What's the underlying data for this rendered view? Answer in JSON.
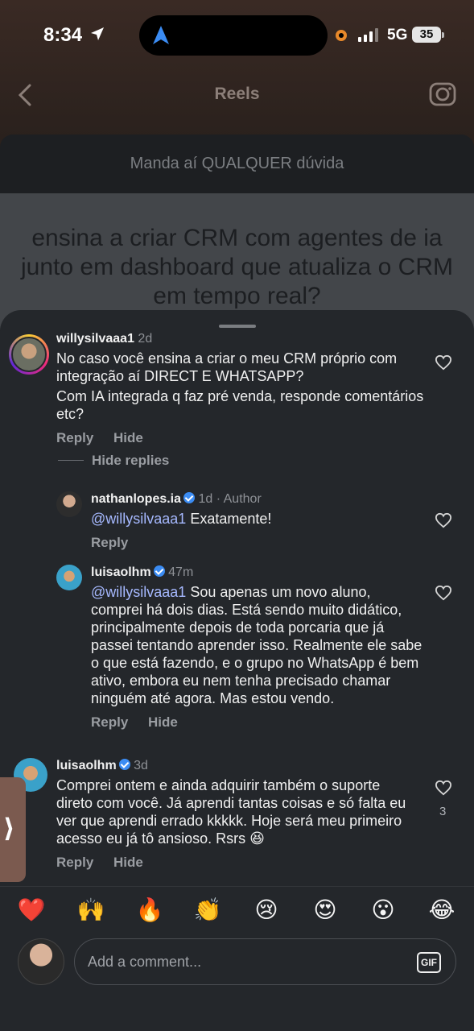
{
  "status": {
    "time": "8:34",
    "network": "5G",
    "battery": "35"
  },
  "nav": {
    "title": "Reels"
  },
  "banner": {
    "text": "Manda aí QUALQUER dúvida"
  },
  "question": {
    "text": "ensina a criar CRM com agentes de ia junto em dashboard que atualiza o CRM em tempo real?"
  },
  "comments": [
    {
      "username": "willysilvaaa1",
      "time": "2d",
      "text1": "No caso você ensina a criar o meu CRM próprio com integração aí DIRECT E WHATSAPP?",
      "text2": "Com IA integrada q faz pré venda, responde comentários etc?",
      "reply": "Reply",
      "hide": "Hide",
      "hide_replies": "Hide replies"
    },
    {
      "username": "nathanlopes.ia",
      "time": "1d",
      "author": "· Author",
      "mention": "@willysilvaaa1",
      "text": " Exatamente!",
      "reply": "Reply"
    },
    {
      "username": "luisaolhm",
      "time": "47m",
      "mention": "@willysilvaaa1",
      "text": " Sou apenas um novo aluno, comprei há dois dias. Está sendo muito didático, principalmente depois de toda porcaria que já passei tentando aprender isso. Realmente ele sabe o que está fazendo, e o grupo no WhatsApp é bem ativo, embora eu nem tenha precisado chamar ninguém até agora. Mas estou vendo.",
      "reply": "Reply",
      "hide": "Hide"
    },
    {
      "username": "luisaolhm",
      "time": "3d",
      "text": "Comprei ontem e ainda adquirir também o suporte direto com você. Já aprendi tantas coisas e só falta eu ver que aprendi errado kkkkk. Hoje será meu primeiro acesso eu já tô ansioso. Rsrs 😆",
      "likes": "3",
      "reply": "Reply",
      "hide": "Hide"
    }
  ],
  "reactions": [
    "❤️",
    "🙌",
    "🔥",
    "👏",
    "😢",
    "😍",
    "😮",
    "😂"
  ],
  "composer": {
    "placeholder": "Add a comment...",
    "gif": "GIF"
  },
  "side_tab": {
    "glyph": "⟩"
  },
  "icons": [
    "location-arrow-icon",
    "navigation-icon",
    "back-chevron-icon",
    "camera-icon",
    "heart-icon",
    "verified-icon"
  ]
}
